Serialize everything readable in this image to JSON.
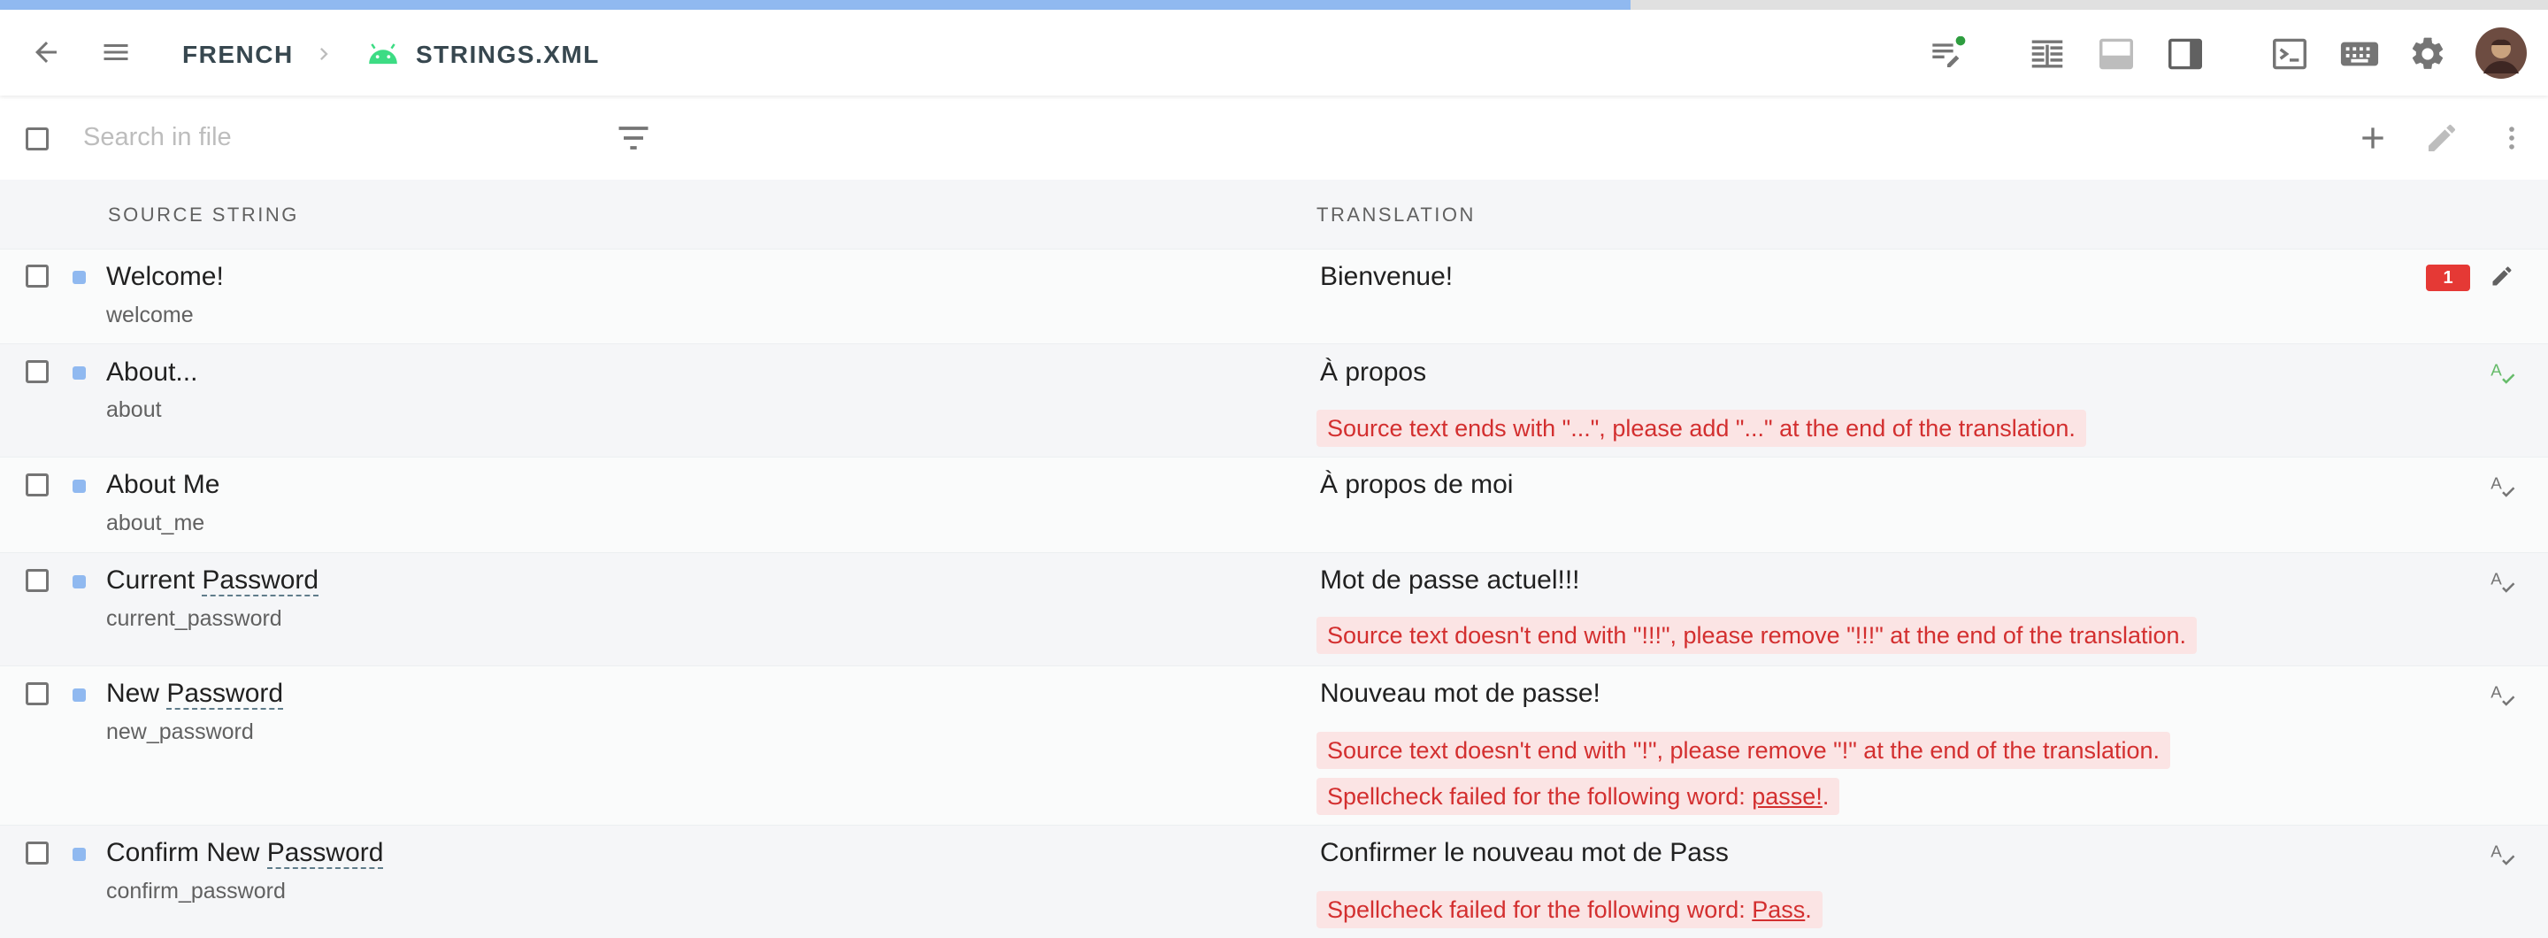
{
  "progress_percent": 64,
  "header": {
    "language": "FRENCH",
    "file_name": "STRINGS.XML"
  },
  "search": {
    "placeholder": "Search in file"
  },
  "columns": {
    "source": "SOURCE STRING",
    "translation": "TRANSLATION"
  },
  "rows": [
    {
      "source": "Welcome!",
      "key": "welcome",
      "translation": "Bienvenue!",
      "issues": [],
      "badge": "1",
      "icon": "edit-icon"
    },
    {
      "source": "About...",
      "key": "about",
      "translation": "À propos",
      "issues": [
        "Source text ends with \"...\", please add \"...\" at the end of the translation."
      ],
      "icon": "spellcheck-icon"
    },
    {
      "source": "About Me",
      "key": "about_me",
      "translation": "À propos de moi",
      "issues": [],
      "icon": "spellcheck-icon"
    },
    {
      "source_prefix": "Current ",
      "source_word": "Password",
      "key": "current_password",
      "translation": "Mot de passe actuel!!!",
      "issues": [
        "Source text doesn't end with \"!!!\", please remove \"!!!\" at the end of the translation."
      ],
      "icon": "spellcheck-icon"
    },
    {
      "source_prefix": "New ",
      "source_word": "Password",
      "key": "new_password",
      "translation": "Nouveau mot de passe!",
      "issues": [
        "Source text doesn't end with \"!\", please remove \"!\" at the end of the translation."
      ],
      "spell_prefix": "Spellcheck failed for the following word: ",
      "spell_word": "passe!",
      "spell_suffix": ".",
      "icon": "spellcheck-icon"
    },
    {
      "source_prefix": "Confirm New ",
      "source_word": "Password",
      "key": "confirm_password",
      "translation": "Confirmer le nouveau mot de Pass",
      "issues": [],
      "spell_prefix": "Spellcheck failed for the following word: ",
      "spell_word": "Pass",
      "spell_suffix": ".",
      "icon": "spellcheck-icon"
    }
  ],
  "colors": {
    "accent": "#90b9f0",
    "error": "#d32f2f",
    "error_bg": "#fbe4e4",
    "online": "#2e9d3f",
    "android": "#3ddc84"
  }
}
